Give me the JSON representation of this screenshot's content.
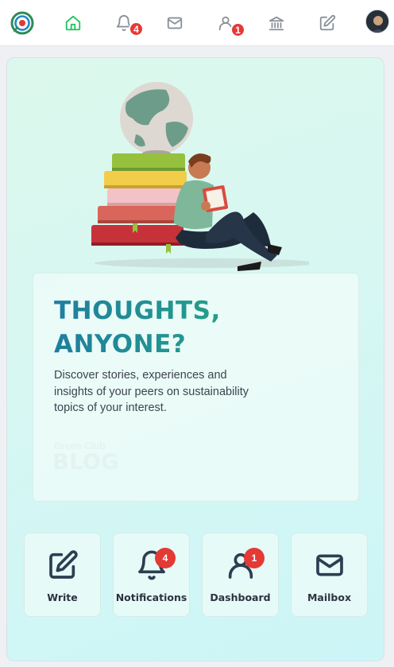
{
  "nav": {
    "notifications_badge": "4",
    "dashboard_badge": "1",
    "icons": [
      "logo-icon",
      "home-icon",
      "bell-icon",
      "mail-icon",
      "user-icon",
      "bank-icon",
      "edit-icon",
      "avatar"
    ],
    "colors": {
      "active": "#22c55e",
      "inactive": "#8a9099",
      "badge": "#e53935"
    }
  },
  "blog": {
    "headline_line1": "THOUGHTS,",
    "headline_line2": "ANYONE?",
    "description": "Discover stories, experiences and insights of your peers on sustainability topics of your interest.",
    "watermark_small": "Green Club",
    "watermark_big": "BLOG"
  },
  "quick_actions": [
    {
      "label": "Write",
      "icon": "edit-icon"
    },
    {
      "label": "Notifications",
      "icon": "bell-icon",
      "badge": "4"
    },
    {
      "label": "Dashboard",
      "icon": "user-icon",
      "badge": "1"
    },
    {
      "label": "Mailbox",
      "icon": "mail-icon"
    }
  ]
}
